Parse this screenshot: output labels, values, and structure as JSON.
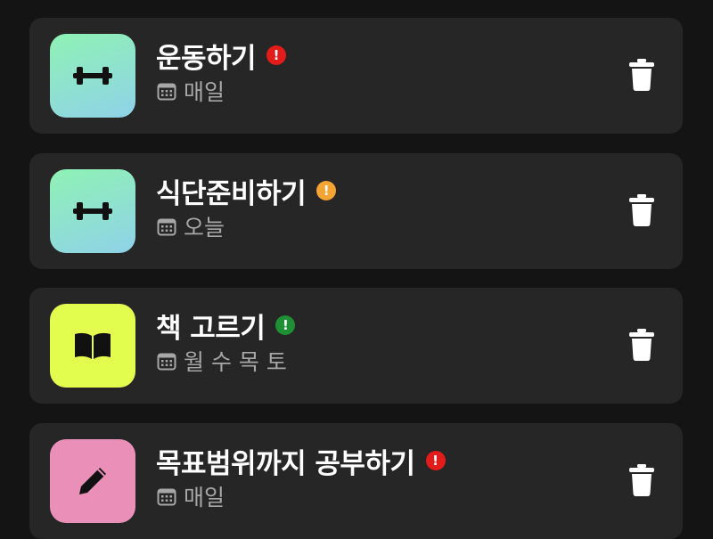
{
  "colors": {
    "background": "#141414",
    "card": "#262626",
    "priority_high": "#e21b1b",
    "priority_medium": "#f3a433",
    "priority_low": "#1f8f35",
    "schedule_text": "#a7a7a7"
  },
  "tasks": [
    {
      "title": "운동하기",
      "schedule": "매일",
      "icon": "dumbbell-icon",
      "priority_mark": "!",
      "priority_color": "#e21b1b",
      "tile_color": "mint gradient"
    },
    {
      "title": "식단준비하기",
      "schedule": "오늘",
      "icon": "dumbbell-icon",
      "priority_mark": "!",
      "priority_color": "#f3a433",
      "tile_color": "mint gradient"
    },
    {
      "title": "책 고르기",
      "schedule": "월 수 목 토",
      "icon": "book-icon",
      "priority_mark": "!",
      "priority_color": "#1f8f35",
      "tile_color": "#e2fd4e"
    },
    {
      "title": "목표범위까지 공부하기",
      "schedule": "매일",
      "icon": "pencil-icon",
      "priority_mark": "!",
      "priority_color": "#e21b1b",
      "tile_color": "#e98fb8"
    }
  ]
}
